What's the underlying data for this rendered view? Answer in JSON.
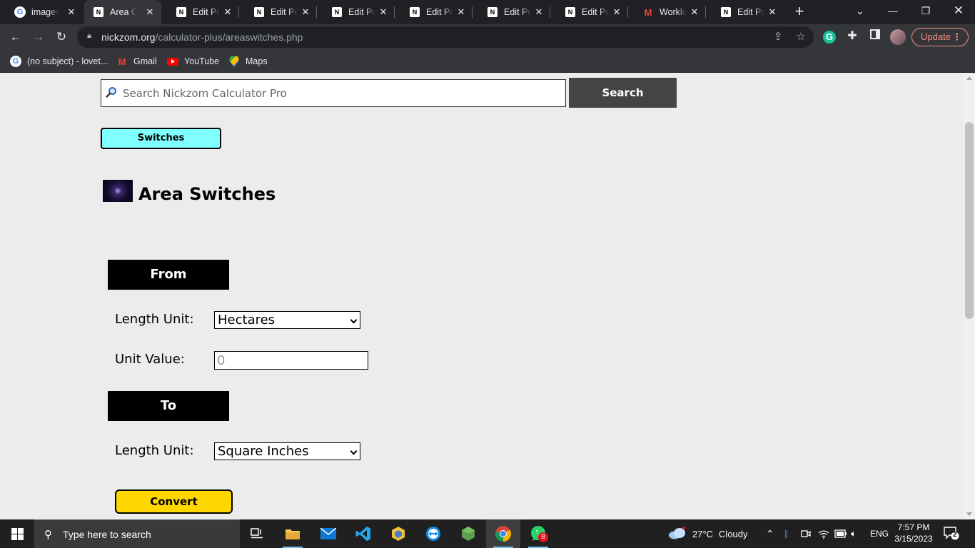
{
  "browser": {
    "tabs": [
      {
        "title": "images c",
        "icon": "google-icon",
        "active": false
      },
      {
        "title": "Area Co",
        "icon": "nickzom-icon",
        "active": true
      },
      {
        "title": "Edit Post",
        "icon": "nickzom-icon",
        "active": false
      },
      {
        "title": "Edit Post",
        "icon": "nickzom-icon",
        "active": false
      },
      {
        "title": "Edit Post",
        "icon": "nickzom-icon",
        "active": false
      },
      {
        "title": "Edit Post",
        "icon": "nickzom-icon",
        "active": false
      },
      {
        "title": "Edit Post",
        "icon": "nickzom-icon",
        "active": false
      },
      {
        "title": "Edit Post",
        "icon": "nickzom-icon",
        "active": false
      },
      {
        "title": "Workloa",
        "icon": "gmail-icon",
        "active": false
      },
      {
        "title": "Edit Post",
        "icon": "nickzom-icon",
        "active": false
      }
    ],
    "url_host": "nickzom.org",
    "url_path": "/calculator-plus/areaswitches.php",
    "update_label": "Update",
    "bookmarks": [
      {
        "label": "(no subject) - lovet...",
        "icon": "google-icon"
      },
      {
        "label": "Gmail",
        "icon": "gmail-icon"
      },
      {
        "label": "YouTube",
        "icon": "youtube-icon"
      },
      {
        "label": "Maps",
        "icon": "maps-icon"
      }
    ]
  },
  "page": {
    "search_placeholder": "Search Nickzom Calculator Pro",
    "search_button": "Search",
    "switches_button": "Switches",
    "title": "Area Switches",
    "from_label": "From",
    "to_label": "To",
    "from_unit_label": "Length Unit:",
    "from_unit_value": "Hectares",
    "unit_value_label": "Unit Value:",
    "unit_value_placeholder": "0",
    "to_unit_label": "Length Unit:",
    "to_unit_value": "Square Inches",
    "convert_button": "Convert"
  },
  "taskbar": {
    "search_placeholder": "Type here to search",
    "weather_temp": "27°C",
    "weather_text": "Cloudy",
    "language": "ENG",
    "time": "7:57 PM",
    "date": "3/15/2023",
    "whatsapp_badge": "8",
    "notification_count": "2"
  },
  "colors": {
    "switches_bg": "#80ffff",
    "convert_bg": "#ffd700",
    "search_btn_bg": "#444444",
    "section_bg": "#000000"
  }
}
